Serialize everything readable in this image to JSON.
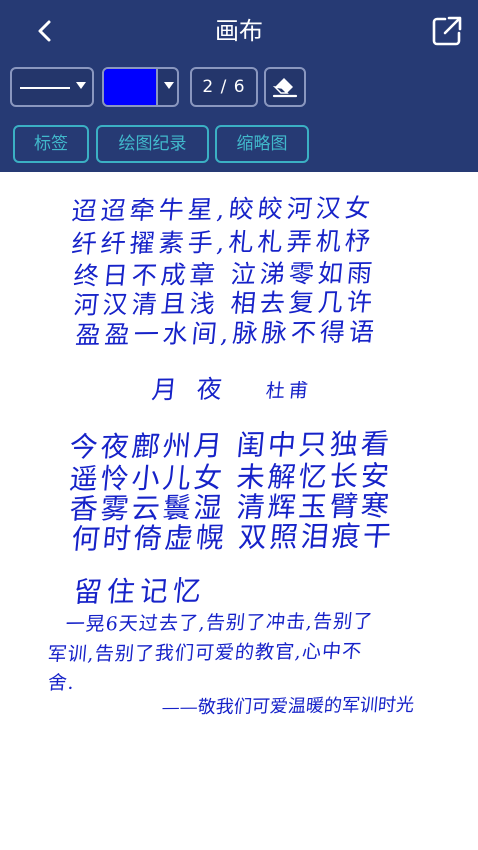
{
  "header": {
    "back_icon": "chevron-left-icon",
    "title": "画布",
    "share_icon": "share-external-icon"
  },
  "toolbar": {
    "line_style": "solid",
    "pen_color": "#0000FF",
    "page_indicator": "2 / 6",
    "eraser_icon": "eraser-icon"
  },
  "tabs": [
    {
      "label": "标签"
    },
    {
      "label": "绘图纪录"
    },
    {
      "label": "缩略图"
    }
  ],
  "canvas": {
    "ink_color": "#1622C8",
    "poem1": [
      "迢迢牵牛星,皎皎河汉女",
      "纤纤擢素手,札札弄机杼",
      "终日不成章 泣涕零如雨",
      "河汉清且浅 相去复几许",
      "盈盈一水间,脉脉不得语"
    ],
    "poem2_title": "月  夜",
    "poem2_author": "杜甫",
    "poem2": [
      "今夜鄜州月 闺中只独看",
      "遥怜小儿女 未解忆长安",
      "香雾云鬟湿 清辉玉臂寒",
      "何时倚虚幌 双照泪痕干"
    ],
    "memo_title": "留住记忆",
    "memo_lines": [
      "一晃6天过去了,告别了冲击,告别了",
      "军训,告别了我们可爱的教官,心中不",
      "舍."
    ],
    "memo_signature": "——敬我们可爱温暖的军训时光"
  }
}
